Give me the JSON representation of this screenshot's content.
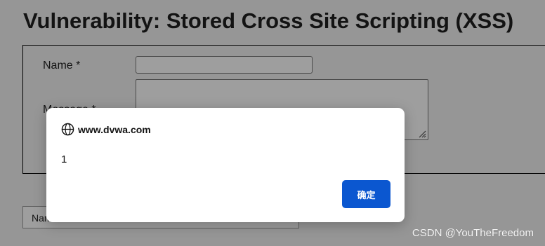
{
  "page": {
    "title": "Vulnerability: Stored Cross Site Scripting (XSS)",
    "form": {
      "name_label": "Name *",
      "message_label": "Message *"
    },
    "lower_field_text": "Name"
  },
  "dialog": {
    "origin": "www.dvwa.com",
    "message": "1",
    "ok_label": "确定"
  },
  "watermark": "CSDN @YouTheFreedom",
  "colors": {
    "accent": "#0b57d0",
    "overlay": "rgba(0,0,0,0.38)"
  }
}
